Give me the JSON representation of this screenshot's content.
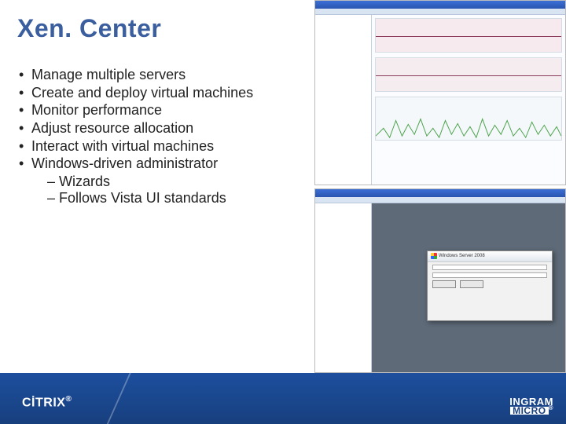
{
  "title": "Xen. Center",
  "bullets": [
    {
      "text": "Manage multiple servers"
    },
    {
      "text": "Create and deploy virtual machines"
    },
    {
      "text": "Monitor performance"
    },
    {
      "text": "Adjust resource allocation"
    },
    {
      "text": "Interact with virtual machines"
    },
    {
      "text": "Windows-driven administrator",
      "subs": [
        "Wizards",
        "Follows Vista UI standards"
      ]
    }
  ],
  "footer": {
    "left_logo": "CİTRIX",
    "left_tm": "®",
    "right_logo_top": "INGRAM",
    "right_logo_bottom": "MICRO",
    "right_tm": "®"
  },
  "screenshots": {
    "top": {
      "desc": "XenCenter performance monitoring window with three stacked charts"
    },
    "bottom": {
      "desc": "XenCenter console with Windows Server dialog",
      "dialog_title": "Windows Server 2008"
    }
  }
}
